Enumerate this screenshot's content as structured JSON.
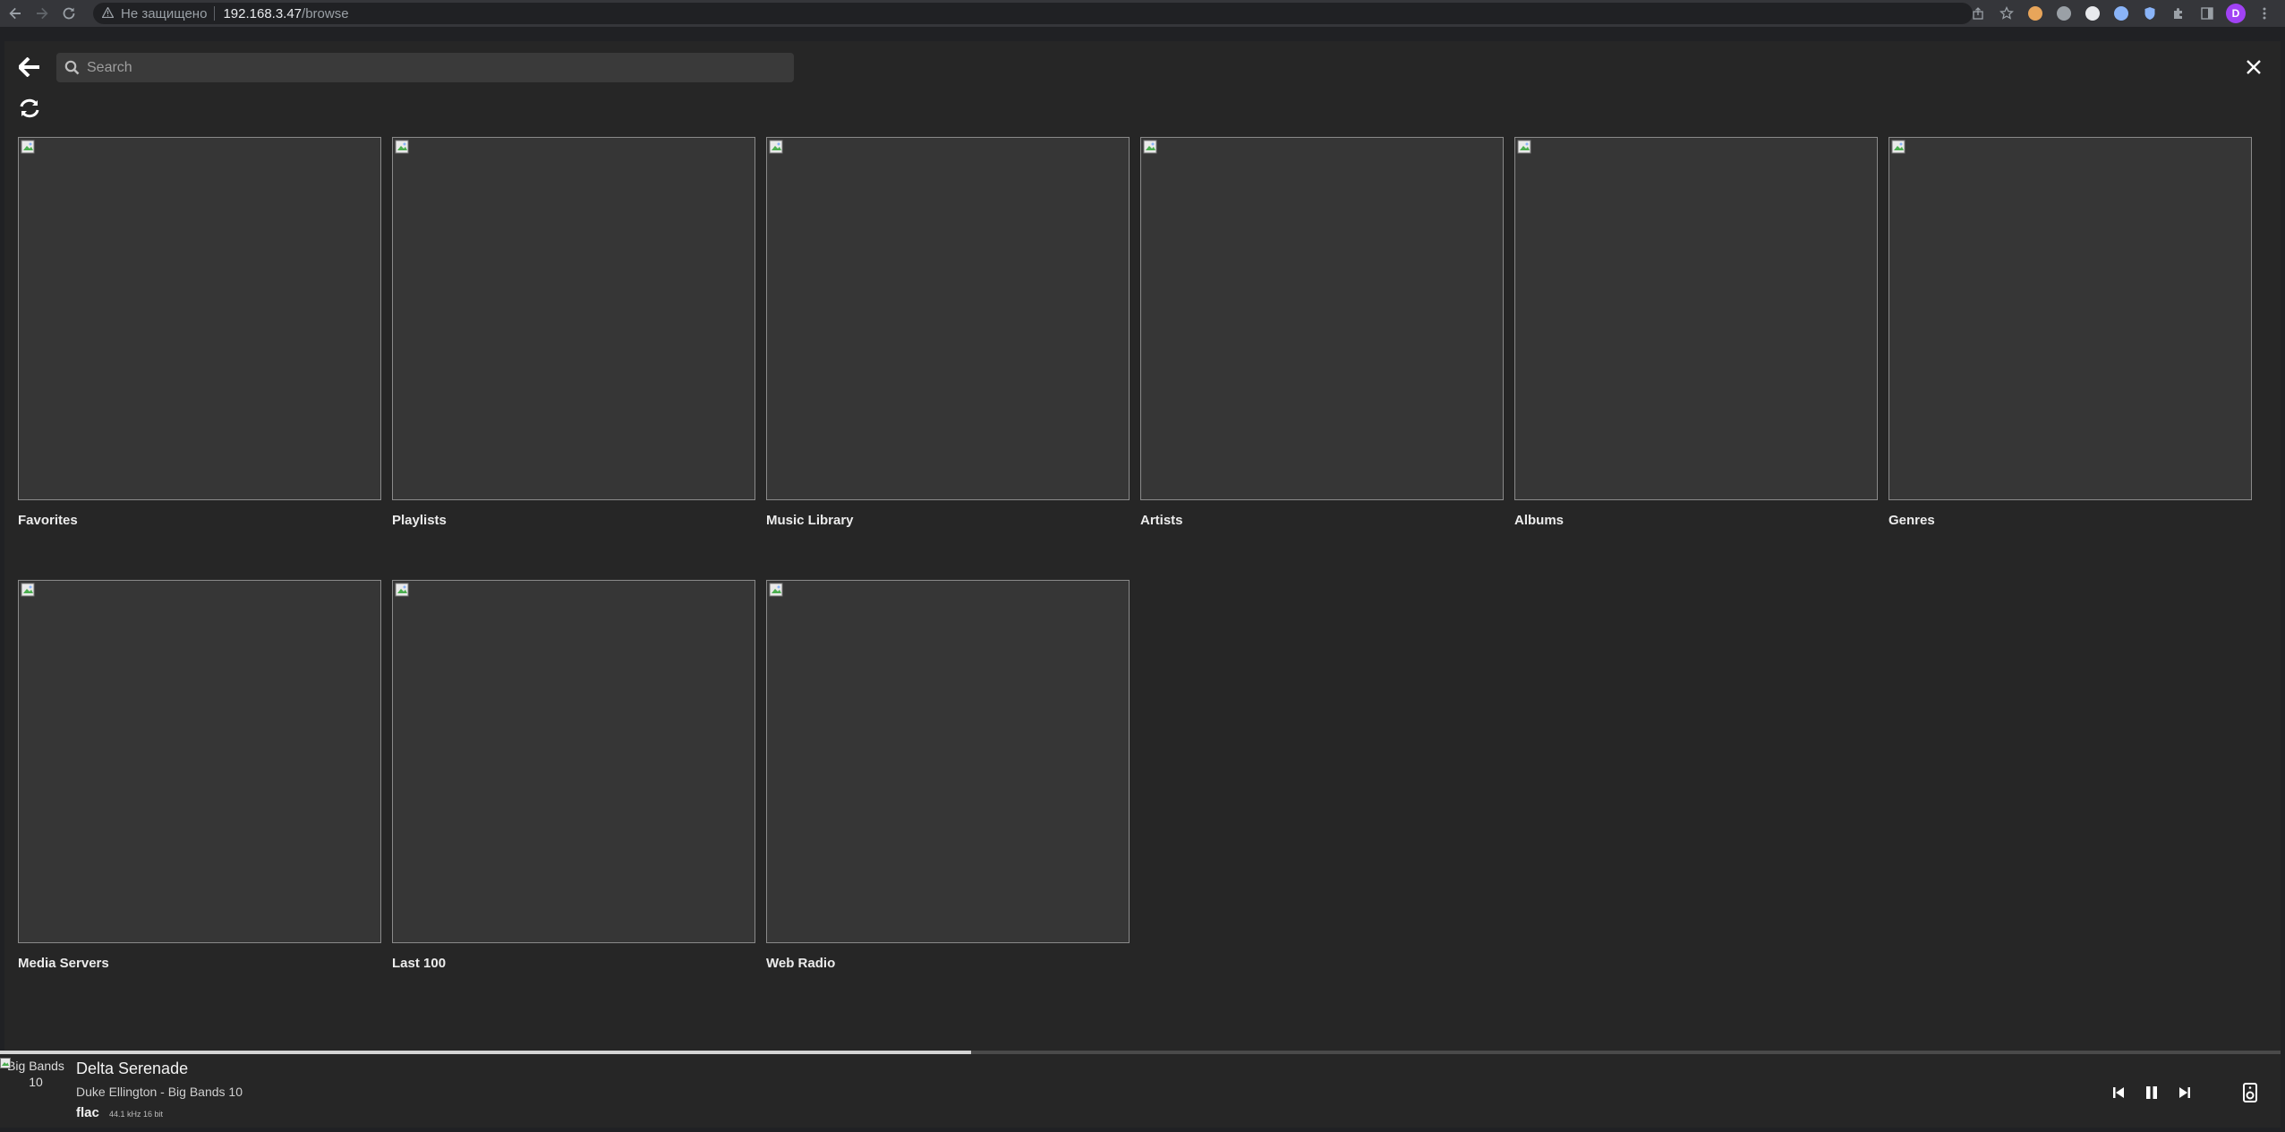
{
  "browser": {
    "not_secure": "Не защищено",
    "url_host": "192.168.3.47",
    "url_path": "/browse",
    "profile_initial": "D"
  },
  "search": {
    "placeholder": "Search"
  },
  "tiles": [
    {
      "label": "Favorites"
    },
    {
      "label": "Playlists"
    },
    {
      "label": "Music Library"
    },
    {
      "label": "Artists"
    },
    {
      "label": "Albums"
    },
    {
      "label": "Genres"
    },
    {
      "label": "Media Servers"
    },
    {
      "label": "Last 100"
    },
    {
      "label": "Web Radio"
    }
  ],
  "player": {
    "cover_alt": "Big Bands 10",
    "title": "Delta Serenade",
    "subtitle": "Duke Ellington - Big Bands 10",
    "format": "flac",
    "quality": "44.1 kHz 16 bit",
    "progress": 0.425
  },
  "colors": {
    "background": "#262626",
    "tile_fill": "#363636",
    "tile_border": "#8a8a8a",
    "progress_fill": "#d4d4d4"
  }
}
